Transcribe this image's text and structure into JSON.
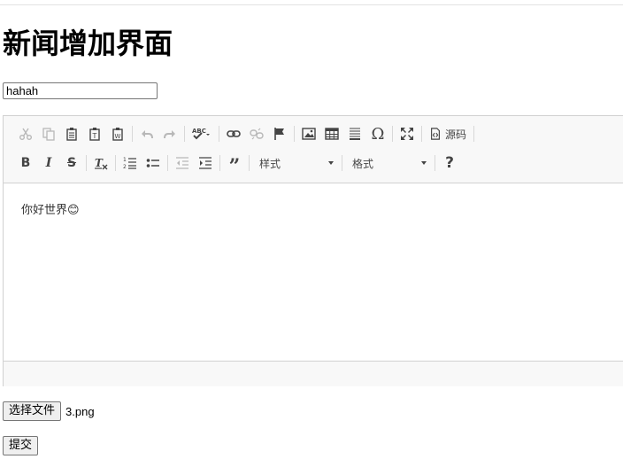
{
  "page": {
    "title": "新闻增加界面"
  },
  "title_input": {
    "value": "hahah"
  },
  "editor": {
    "toolbar": {
      "row1": [
        {
          "name": "cut-icon",
          "glyph": "✂",
          "disabled": true
        },
        {
          "name": "copy-icon",
          "glyph": "⎘",
          "disabled": true
        },
        {
          "name": "paste-icon",
          "glyph": "📋"
        },
        {
          "name": "paste-text-icon",
          "glyph": "T"
        },
        {
          "name": "paste-word-icon",
          "glyph": "W"
        },
        {
          "name": "undo-icon",
          "glyph": "↶",
          "disabled": true
        },
        {
          "name": "redo-icon",
          "glyph": "↷",
          "disabled": true
        },
        {
          "name": "spellcheck-icon",
          "glyph": "ABC✓"
        },
        {
          "name": "link-icon",
          "glyph": "🔗"
        },
        {
          "name": "unlink-icon",
          "glyph": "⛓",
          "disabled": true
        },
        {
          "name": "anchor-flag-icon",
          "glyph": "⚑"
        },
        {
          "name": "image-icon",
          "glyph": "▣"
        },
        {
          "name": "table-icon",
          "glyph": "▦"
        },
        {
          "name": "horizontal-rule-icon",
          "glyph": "≡"
        },
        {
          "name": "special-char-icon",
          "glyph": "Ω"
        },
        {
          "name": "maximize-icon",
          "glyph": "⤢"
        }
      ],
      "source_label": "源码",
      "row2": [
        {
          "name": "bold-icon",
          "glyph": "B"
        },
        {
          "name": "italic-icon",
          "glyph": "I"
        },
        {
          "name": "strikethrough-icon",
          "glyph": "S"
        },
        {
          "name": "remove-format-icon",
          "glyph": "Tx"
        },
        {
          "name": "numbered-list-icon",
          "glyph": "1≡"
        },
        {
          "name": "bulleted-list-icon",
          "glyph": "•≡"
        },
        {
          "name": "outdent-icon",
          "glyph": "⇤",
          "disabled": true
        },
        {
          "name": "indent-icon",
          "glyph": "⇥"
        },
        {
          "name": "blockquote-icon",
          "glyph": "❞"
        }
      ],
      "style_combo": "样式",
      "format_combo": "格式",
      "help_glyph": "?"
    },
    "content_text": "你好世界😊"
  },
  "file_picker": {
    "button_label": "选择文件",
    "file_name": "3.png"
  },
  "submit": {
    "label": "提交"
  }
}
